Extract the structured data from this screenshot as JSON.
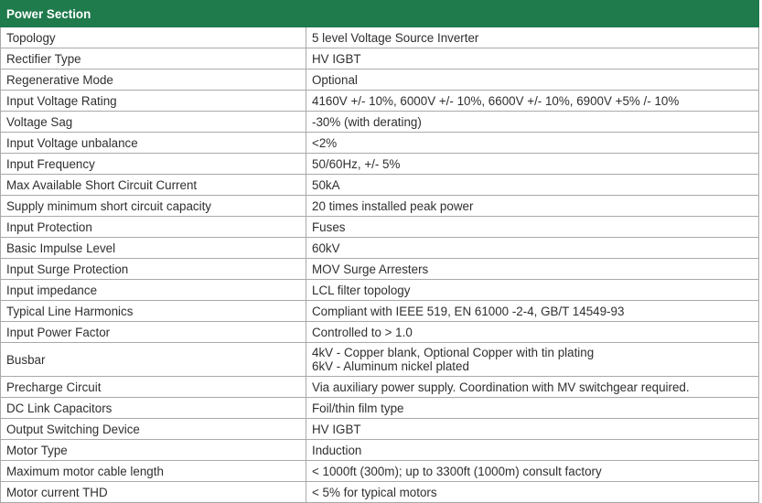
{
  "section_title": "Power Section",
  "rows": [
    {
      "label": "Topology",
      "value": [
        "5 level Voltage Source Inverter"
      ]
    },
    {
      "label": "Rectifier Type",
      "value": [
        "HV IGBT"
      ]
    },
    {
      "label": "Regenerative Mode",
      "value": [
        "Optional"
      ]
    },
    {
      "label": "Input Voltage Rating",
      "value": [
        "4160V +/- 10%, 6000V +/- 10%, 6600V +/- 10%, 6900V +5% /- 10%"
      ]
    },
    {
      "label": "Voltage Sag",
      "value": [
        "-30% (with derating)"
      ]
    },
    {
      "label": "Input Voltage unbalance",
      "value": [
        "<2%"
      ]
    },
    {
      "label": "Input Frequency",
      "value": [
        "50/60Hz, +/- 5%"
      ]
    },
    {
      "label": "Max Available Short Circuit Current",
      "value": [
        "50kA"
      ]
    },
    {
      "label": "Supply minimum short circuit capacity",
      "value": [
        "20 times installed peak power"
      ]
    },
    {
      "label": "Input Protection",
      "value": [
        "Fuses"
      ]
    },
    {
      "label": "Basic Impulse Level",
      "value": [
        "60kV"
      ]
    },
    {
      "label": "Input Surge Protection",
      "value": [
        "MOV Surge Arresters"
      ]
    },
    {
      "label": "Input impedance",
      "value": [
        "LCL filter topology"
      ]
    },
    {
      "label": "Typical Line Harmonics",
      "value": [
        "Compliant with IEEE 519, EN 61000 -2-4, GB/T 14549-93"
      ]
    },
    {
      "label": "Input Power Factor",
      "value": [
        "Controlled to > 1.0"
      ]
    },
    {
      "label": "Busbar",
      "value": [
        "4kV - Copper blank, Optional Copper with tin plating",
        "6kV - Aluminum nickel plated"
      ]
    },
    {
      "label": "Precharge Circuit",
      "value": [
        "Via auxiliary power supply. Coordination with MV switchgear required."
      ]
    },
    {
      "label": "DC Link Capacitors",
      "value": [
        "Foil/thin film type"
      ]
    },
    {
      "label": "Output Switching Device",
      "value": [
        "HV IGBT"
      ]
    },
    {
      "label": "Motor Type",
      "value": [
        "Induction"
      ]
    },
    {
      "label": "Maximum motor cable length",
      "value": [
        "< 1000ft (300m); up to 3300ft (1000m) consult factory"
      ]
    },
    {
      "label": "Motor current THD",
      "value": [
        "< 5% for typical motors"
      ]
    }
  ]
}
